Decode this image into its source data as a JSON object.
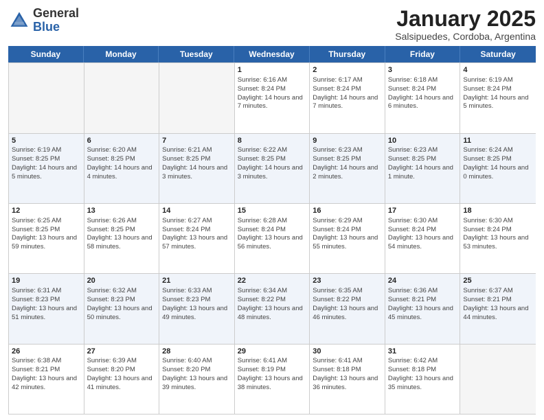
{
  "header": {
    "logo_general": "General",
    "logo_blue": "Blue",
    "month_title": "January 2025",
    "location": "Salsipuedes, Cordoba, Argentina"
  },
  "days_of_week": [
    "Sunday",
    "Monday",
    "Tuesday",
    "Wednesday",
    "Thursday",
    "Friday",
    "Saturday"
  ],
  "weeks": [
    [
      {
        "day": "",
        "sunrise": "",
        "sunset": "",
        "daylight": "",
        "empty": true
      },
      {
        "day": "",
        "sunrise": "",
        "sunset": "",
        "daylight": "",
        "empty": true
      },
      {
        "day": "",
        "sunrise": "",
        "sunset": "",
        "daylight": "",
        "empty": true
      },
      {
        "day": "1",
        "sunrise": "Sunrise: 6:16 AM",
        "sunset": "Sunset: 8:24 PM",
        "daylight": "Daylight: 14 hours and 7 minutes.",
        "empty": false
      },
      {
        "day": "2",
        "sunrise": "Sunrise: 6:17 AM",
        "sunset": "Sunset: 8:24 PM",
        "daylight": "Daylight: 14 hours and 7 minutes.",
        "empty": false
      },
      {
        "day": "3",
        "sunrise": "Sunrise: 6:18 AM",
        "sunset": "Sunset: 8:24 PM",
        "daylight": "Daylight: 14 hours and 6 minutes.",
        "empty": false
      },
      {
        "day": "4",
        "sunrise": "Sunrise: 6:19 AM",
        "sunset": "Sunset: 8:24 PM",
        "daylight": "Daylight: 14 hours and 5 minutes.",
        "empty": false
      }
    ],
    [
      {
        "day": "5",
        "sunrise": "Sunrise: 6:19 AM",
        "sunset": "Sunset: 8:25 PM",
        "daylight": "Daylight: 14 hours and 5 minutes.",
        "empty": false
      },
      {
        "day": "6",
        "sunrise": "Sunrise: 6:20 AM",
        "sunset": "Sunset: 8:25 PM",
        "daylight": "Daylight: 14 hours and 4 minutes.",
        "empty": false
      },
      {
        "day": "7",
        "sunrise": "Sunrise: 6:21 AM",
        "sunset": "Sunset: 8:25 PM",
        "daylight": "Daylight: 14 hours and 3 minutes.",
        "empty": false
      },
      {
        "day": "8",
        "sunrise": "Sunrise: 6:22 AM",
        "sunset": "Sunset: 8:25 PM",
        "daylight": "Daylight: 14 hours and 3 minutes.",
        "empty": false
      },
      {
        "day": "9",
        "sunrise": "Sunrise: 6:23 AM",
        "sunset": "Sunset: 8:25 PM",
        "daylight": "Daylight: 14 hours and 2 minutes.",
        "empty": false
      },
      {
        "day": "10",
        "sunrise": "Sunrise: 6:23 AM",
        "sunset": "Sunset: 8:25 PM",
        "daylight": "Daylight: 14 hours and 1 minute.",
        "empty": false
      },
      {
        "day": "11",
        "sunrise": "Sunrise: 6:24 AM",
        "sunset": "Sunset: 8:25 PM",
        "daylight": "Daylight: 14 hours and 0 minutes.",
        "empty": false
      }
    ],
    [
      {
        "day": "12",
        "sunrise": "Sunrise: 6:25 AM",
        "sunset": "Sunset: 8:25 PM",
        "daylight": "Daylight: 13 hours and 59 minutes.",
        "empty": false
      },
      {
        "day": "13",
        "sunrise": "Sunrise: 6:26 AM",
        "sunset": "Sunset: 8:25 PM",
        "daylight": "Daylight: 13 hours and 58 minutes.",
        "empty": false
      },
      {
        "day": "14",
        "sunrise": "Sunrise: 6:27 AM",
        "sunset": "Sunset: 8:24 PM",
        "daylight": "Daylight: 13 hours and 57 minutes.",
        "empty": false
      },
      {
        "day": "15",
        "sunrise": "Sunrise: 6:28 AM",
        "sunset": "Sunset: 8:24 PM",
        "daylight": "Daylight: 13 hours and 56 minutes.",
        "empty": false
      },
      {
        "day": "16",
        "sunrise": "Sunrise: 6:29 AM",
        "sunset": "Sunset: 8:24 PM",
        "daylight": "Daylight: 13 hours and 55 minutes.",
        "empty": false
      },
      {
        "day": "17",
        "sunrise": "Sunrise: 6:30 AM",
        "sunset": "Sunset: 8:24 PM",
        "daylight": "Daylight: 13 hours and 54 minutes.",
        "empty": false
      },
      {
        "day": "18",
        "sunrise": "Sunrise: 6:30 AM",
        "sunset": "Sunset: 8:24 PM",
        "daylight": "Daylight: 13 hours and 53 minutes.",
        "empty": false
      }
    ],
    [
      {
        "day": "19",
        "sunrise": "Sunrise: 6:31 AM",
        "sunset": "Sunset: 8:23 PM",
        "daylight": "Daylight: 13 hours and 51 minutes.",
        "empty": false
      },
      {
        "day": "20",
        "sunrise": "Sunrise: 6:32 AM",
        "sunset": "Sunset: 8:23 PM",
        "daylight": "Daylight: 13 hours and 50 minutes.",
        "empty": false
      },
      {
        "day": "21",
        "sunrise": "Sunrise: 6:33 AM",
        "sunset": "Sunset: 8:23 PM",
        "daylight": "Daylight: 13 hours and 49 minutes.",
        "empty": false
      },
      {
        "day": "22",
        "sunrise": "Sunrise: 6:34 AM",
        "sunset": "Sunset: 8:22 PM",
        "daylight": "Daylight: 13 hours and 48 minutes.",
        "empty": false
      },
      {
        "day": "23",
        "sunrise": "Sunrise: 6:35 AM",
        "sunset": "Sunset: 8:22 PM",
        "daylight": "Daylight: 13 hours and 46 minutes.",
        "empty": false
      },
      {
        "day": "24",
        "sunrise": "Sunrise: 6:36 AM",
        "sunset": "Sunset: 8:21 PM",
        "daylight": "Daylight: 13 hours and 45 minutes.",
        "empty": false
      },
      {
        "day": "25",
        "sunrise": "Sunrise: 6:37 AM",
        "sunset": "Sunset: 8:21 PM",
        "daylight": "Daylight: 13 hours and 44 minutes.",
        "empty": false
      }
    ],
    [
      {
        "day": "26",
        "sunrise": "Sunrise: 6:38 AM",
        "sunset": "Sunset: 8:21 PM",
        "daylight": "Daylight: 13 hours and 42 minutes.",
        "empty": false
      },
      {
        "day": "27",
        "sunrise": "Sunrise: 6:39 AM",
        "sunset": "Sunset: 8:20 PM",
        "daylight": "Daylight: 13 hours and 41 minutes.",
        "empty": false
      },
      {
        "day": "28",
        "sunrise": "Sunrise: 6:40 AM",
        "sunset": "Sunset: 8:20 PM",
        "daylight": "Daylight: 13 hours and 39 minutes.",
        "empty": false
      },
      {
        "day": "29",
        "sunrise": "Sunrise: 6:41 AM",
        "sunset": "Sunset: 8:19 PM",
        "daylight": "Daylight: 13 hours and 38 minutes.",
        "empty": false
      },
      {
        "day": "30",
        "sunrise": "Sunrise: 6:41 AM",
        "sunset": "Sunset: 8:18 PM",
        "daylight": "Daylight: 13 hours and 36 minutes.",
        "empty": false
      },
      {
        "day": "31",
        "sunrise": "Sunrise: 6:42 AM",
        "sunset": "Sunset: 8:18 PM",
        "daylight": "Daylight: 13 hours and 35 minutes.",
        "empty": false
      },
      {
        "day": "",
        "sunrise": "",
        "sunset": "",
        "daylight": "",
        "empty": true
      }
    ]
  ]
}
